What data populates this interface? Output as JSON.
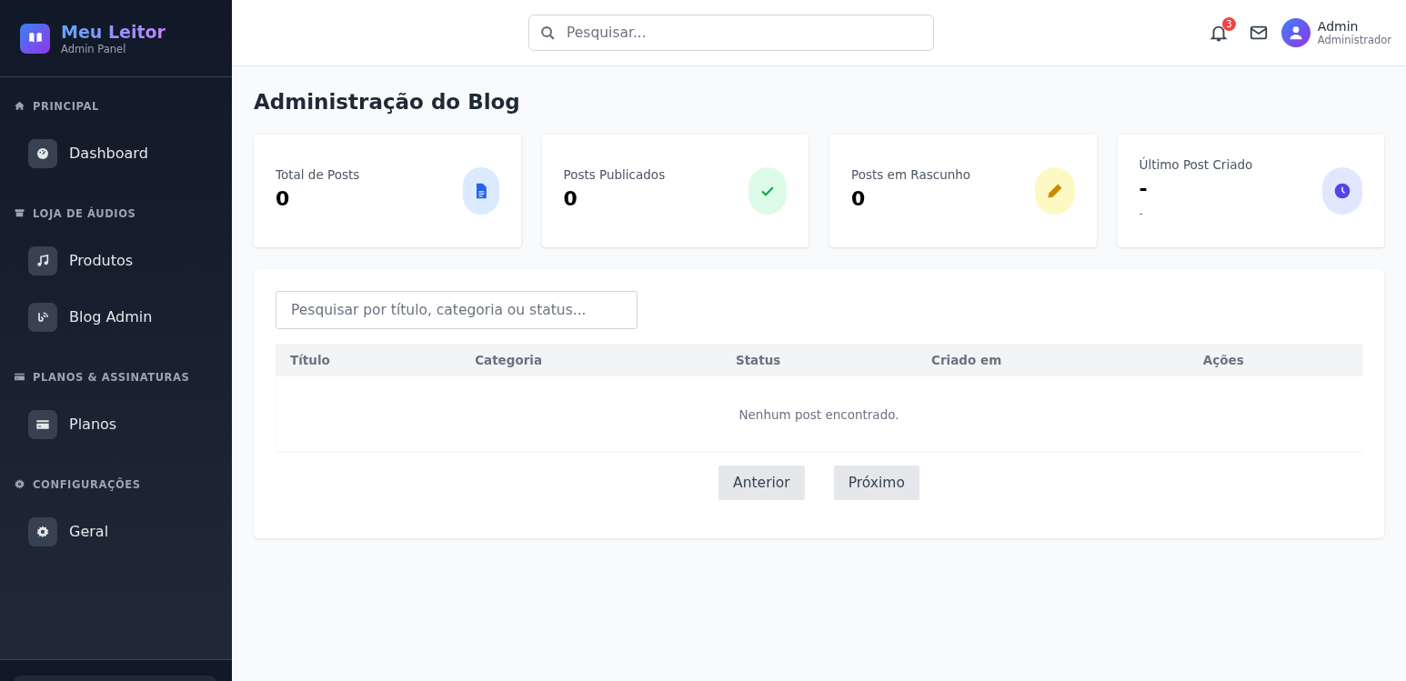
{
  "brand": {
    "title": "Meu Leitor",
    "subtitle": "Admin Panel"
  },
  "sidebar": {
    "sections": [
      {
        "title": "PRINCIPAL",
        "items": [
          "Dashboard"
        ]
      },
      {
        "title": "LOJA DE ÁUDIOS",
        "items": [
          "Produtos",
          "Blog Admin"
        ]
      },
      {
        "title": "PLANOS & ASSINATURAS",
        "items": [
          "Planos"
        ]
      },
      {
        "title": "CONFIGURAÇÕES",
        "items": [
          "Geral"
        ]
      }
    ]
  },
  "header": {
    "search": {
      "placeholder": "Pesquisar..."
    },
    "notifications": "3",
    "user": {
      "name": "Admin",
      "role": "Administrador"
    }
  },
  "page_title": "Administração do Blog",
  "stats": [
    {
      "label": "Total de Posts",
      "value": "0",
      "color": "#2563eb"
    },
    {
      "label": "Posts Publicados",
      "value": "0",
      "color": "#16a34a"
    },
    {
      "label": "Posts em Rascunho",
      "value": "0",
      "color": "#ca8a04"
    },
    {
      "label": "Último Post Criado",
      "value": "-",
      "detail": "-",
      "color": "#4f46e5"
    }
  ],
  "posts": {
    "search": {
      "placeholder": "Pesquisar por título, categoria ou status..."
    },
    "table": {
      "columns": [
        "Título",
        "Categoria",
        "Status",
        "Criado em",
        "Ações"
      ],
      "empty_message": "Nenhum post encontrado."
    },
    "pagination": [
      "Anterior",
      "Próximo"
    ]
  }
}
